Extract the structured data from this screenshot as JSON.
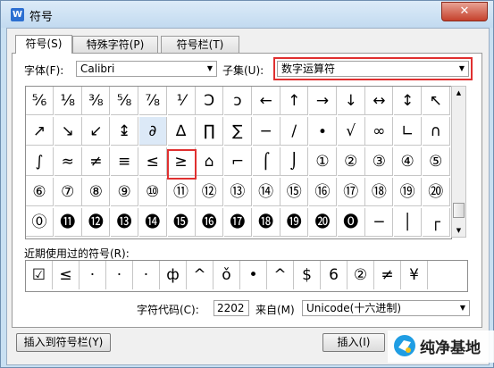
{
  "window": {
    "title": "符号",
    "close_icon": "close-icon"
  },
  "tabs": [
    {
      "label": "符号(S)"
    },
    {
      "label": "特殊字符(P)"
    },
    {
      "label": "符号栏(T)"
    }
  ],
  "font": {
    "label": "字体(F):",
    "value": "Calibri"
  },
  "subset": {
    "label": "子集(U):",
    "value": "数字运算符"
  },
  "symbols": [
    [
      "⅚",
      "⅛",
      "⅜",
      "⅝",
      "⅞",
      "⅟",
      "Ↄ",
      "ↄ",
      "←",
      "↑",
      "→",
      "↓",
      "↔",
      "↕",
      "↖"
    ],
    [
      "↗",
      "↘",
      "↙",
      "↨",
      "∂",
      "∆",
      "∏",
      "∑",
      "−",
      "∕",
      "∙",
      "√",
      "∞",
      "∟",
      "∩"
    ],
    [
      "∫",
      "≈",
      "≠",
      "≡",
      "≤",
      "≥",
      "⌂",
      "⌐",
      "⌠",
      "⌡",
      "①",
      "②",
      "③",
      "④",
      "⑤"
    ],
    [
      "⑥",
      "⑦",
      "⑧",
      "⑨",
      "⑩",
      "⑪",
      "⑫",
      "⑬",
      "⑭",
      "⑮",
      "⑯",
      "⑰",
      "⑱",
      "⑲",
      "⑳"
    ],
    [
      "⓪",
      "⓫",
      "⓬",
      "⓭",
      "⓮",
      "⓯",
      "⓰",
      "⓱",
      "⓲",
      "⓳",
      "⓴",
      "⓿",
      "─",
      "│",
      "┌"
    ]
  ],
  "recent": {
    "label": "近期使用过的符号(R):",
    "items": [
      "☑",
      "≤",
      "·",
      "·",
      "·",
      "ф",
      "^",
      "ǒ",
      "•",
      "^",
      "$",
      "6",
      "②",
      "≠",
      "¥"
    ]
  },
  "charcode": {
    "label": "字符代码(C):",
    "value": "2202"
  },
  "from": {
    "label": "来自(M)",
    "value": "Unicode(十六进制)"
  },
  "buttons": {
    "insert_to_bar": "插入到符号栏(Y)",
    "insert": "插入(I)"
  },
  "watermark": {
    "text": "纯净基地"
  },
  "colors": {
    "highlight": "#e03030",
    "selected_cell": "#dce9f7"
  }
}
